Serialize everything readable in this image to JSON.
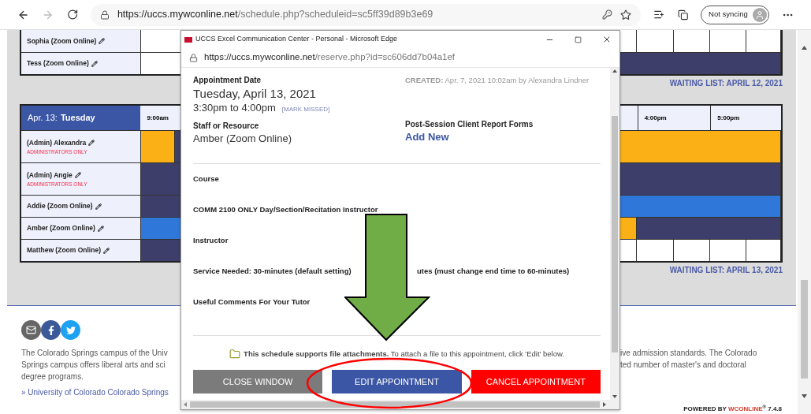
{
  "browser": {
    "url_host": "https://uccs.mywconline.net",
    "url_path": "/schedule.php?scheduleid=sc5ff39d89b3e69",
    "sync_label": "Not syncing"
  },
  "schedule": [
    {
      "rows": [
        {
          "name": "Sophia (Zoom Online)",
          "left_slots": [
            {
              "color": "#ffffff"
            },
            {
              "color": "#ffffff"
            }
          ],
          "right_slots": [
            {
              "color": "#ffffff"
            },
            {
              "color": "#ffffff"
            },
            {
              "color": "#ffffff"
            },
            {
              "color": "#ffffff"
            },
            {
              "color": "#ffffff"
            }
          ]
        },
        {
          "name": "Tess (Zoom Online)",
          "left_slots": [
            {
              "color": "#ffffff"
            },
            {
              "color": "#ffffff"
            }
          ],
          "right_slots": [
            {
              "color": "#3e3e6a"
            },
            {
              "color": "#3e3e6a"
            },
            {
              "color": "#3e3e6a"
            },
            {
              "color": "#3e3e6a"
            },
            {
              "color": "#3e3e6a"
            }
          ]
        }
      ],
      "waiting_list": "WAITING LIST: APRIL 12, 2021"
    },
    {
      "header": {
        "date": "Apr. 13:",
        "weekday": "Tuesday",
        "times_left": [
          "9:00am"
        ],
        "times_right": [
          "4:00pm",
          "5:00pm"
        ]
      },
      "rows": [
        {
          "name": "(Admin) Alexandra",
          "note": "ADMINISTRATORS ONLY",
          "left_slots": [
            {
              "color": "#fbb015"
            },
            {
              "color": "#3e3e6a"
            }
          ],
          "right_slots": [
            {
              "color": "#fbb015"
            },
            {
              "color": "#fbb015"
            },
            {
              "color": "#fbb015"
            },
            {
              "color": "#fbb015"
            },
            {
              "color": "#fbb015"
            }
          ]
        },
        {
          "name": "(Admin) Angie",
          "note": "ADMINISTRATORS ONLY",
          "left_slots": [
            {
              "color": "#3e3e6a"
            },
            {
              "color": "#3e3e6a"
            }
          ],
          "right_slots": [
            {
              "color": "#3e3e6a"
            },
            {
              "color": "#3e3e6a"
            },
            {
              "color": "#3e3e6a"
            },
            {
              "color": "#3e3e6a"
            },
            {
              "color": "#3e3e6a"
            }
          ]
        },
        {
          "name": "Addie (Zoom Online)",
          "left_slots": [
            {
              "color": "#3e3e6a"
            },
            {
              "color": "#3e3e6a"
            }
          ],
          "right_slots": [
            {
              "color": "#2f77d9"
            },
            {
              "color": "#2f77d9"
            },
            {
              "color": "#2f77d9"
            },
            {
              "color": "#2f77d9"
            },
            {
              "color": "#2f77d9"
            }
          ]
        },
        {
          "name": "Amber (Zoom Online)",
          "left_slots": [
            {
              "color": "#2f77d9"
            },
            {
              "color": "#2f77d9"
            }
          ],
          "right_slots": [
            {
              "color": "#fbb015"
            },
            {
              "color": "#3e3e6a"
            },
            {
              "color": "#3e3e6a"
            },
            {
              "color": "#3e3e6a"
            },
            {
              "color": "#3e3e6a"
            }
          ]
        },
        {
          "name": "Matthew (Zoom Online)",
          "left_slots": [
            {
              "color": "#3e3e6a"
            },
            {
              "color": "#3e3e6a"
            }
          ],
          "right_slots": [
            {
              "color": "#ffffff"
            },
            {
              "color": "#ffffff"
            },
            {
              "color": "#ffffff"
            },
            {
              "color": "#ffffff"
            },
            {
              "color": "#ffffff"
            }
          ]
        }
      ],
      "waiting_list": "WAITING LIST: APRIL 13, 2021"
    }
  ],
  "footer": {
    "left_lines": [
      "The Colorado Springs campus of the Univ",
      "Springs campus offers liberal arts and sci",
      "degree programs."
    ],
    "right_lines": [
      "ive admission standards. The Colorado",
      "ted number of master's and doctoral"
    ],
    "link": "» University of Colorado Colorado Springs",
    "powered_by": {
      "label": "POWERED BY",
      "brand": "WCONLINE",
      "mark": "®",
      "version": "7.4.8"
    }
  },
  "popup": {
    "title": "UCCS Excel Communication Center - Personal - Microsoft Edge",
    "url_host": "https://uccs.mywconline.net",
    "url_path": "/reserve.php?id=sc606dd7b04a1ef",
    "appointment_label": "Appointment Date",
    "date": "Tuesday, April 13, 2021",
    "time": "3:30pm to 4:00pm",
    "mark_missed": "[MARK MISSED]",
    "created": "**CREATED:** Apr. 7, 2021 10:02am by Alexandra Lindner",
    "staff_label": "Staff or Resource",
    "staff": "Amber (Zoom Online)",
    "forms_label": "Post-Session Client Report Forms",
    "forms_link": "Add New",
    "fields": [
      {
        "label": "Course"
      },
      {
        "label": "COMM 2100 ONLY Day/Section/Recitation Instructor"
      },
      {
        "label": "Instructor"
      },
      {
        "label": "Service Needed: 30-minutes (default setting)",
        "label_rest": "utes (must change end time to 60-minutes)"
      },
      {
        "label": "Useful Comments For Your Tutor"
      }
    ],
    "attachments_note": "**This schedule supports file attachments.** To attach a file to this appointment, click 'Edit' below.",
    "buttons": [
      {
        "label": "CLOSE WINDOW",
        "kind": "close"
      },
      {
        "label": "EDIT APPOINTMENT",
        "kind": "edit"
      },
      {
        "label": "CANCEL APPOINTMENT",
        "kind": "cancel"
      }
    ]
  }
}
